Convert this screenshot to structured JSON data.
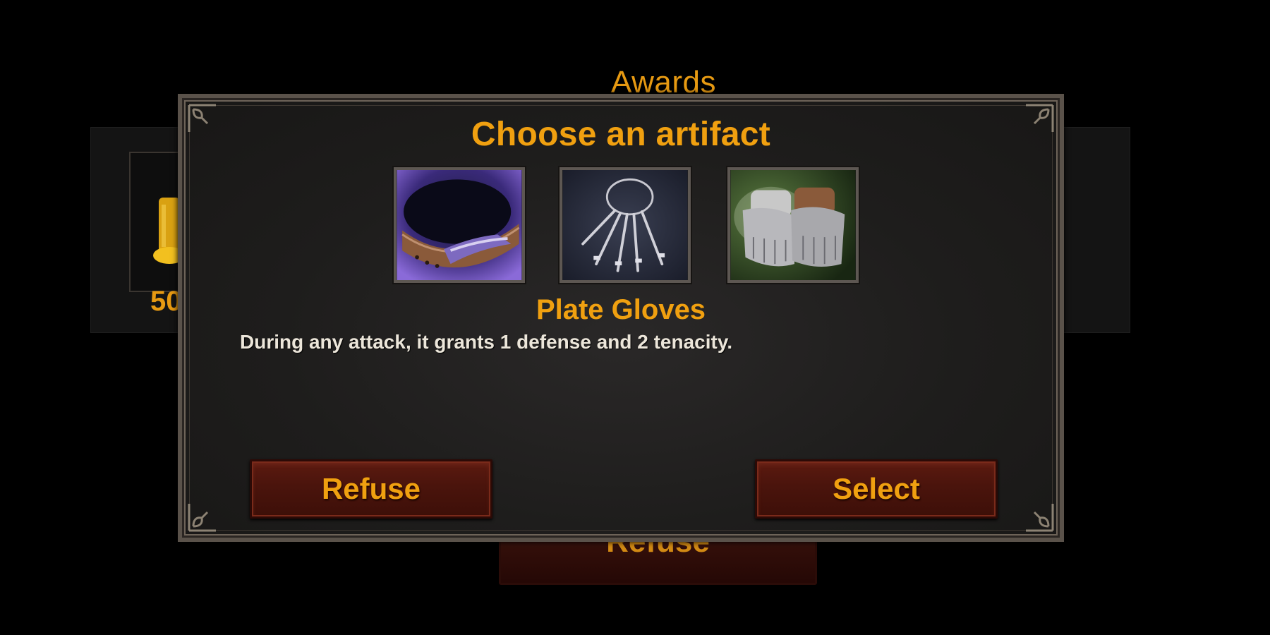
{
  "background": {
    "title": "Awards",
    "reward_count": "50",
    "refuse_label": "Refuse"
  },
  "dialog": {
    "title": "Choose an artifact",
    "artifacts": [
      {
        "icon": "collar-icon"
      },
      {
        "icon": "keyring-icon"
      },
      {
        "icon": "plate-gloves-icon"
      }
    ],
    "selected": {
      "name": "Plate Gloves",
      "description": "During any attack, it grants 1 defense and 2 tenacity."
    },
    "buttons": {
      "refuse": "Refuse",
      "select": "Select"
    }
  },
  "colors": {
    "accent": "#f0a010",
    "button": "#4a140c",
    "frame": "#5a524a"
  }
}
